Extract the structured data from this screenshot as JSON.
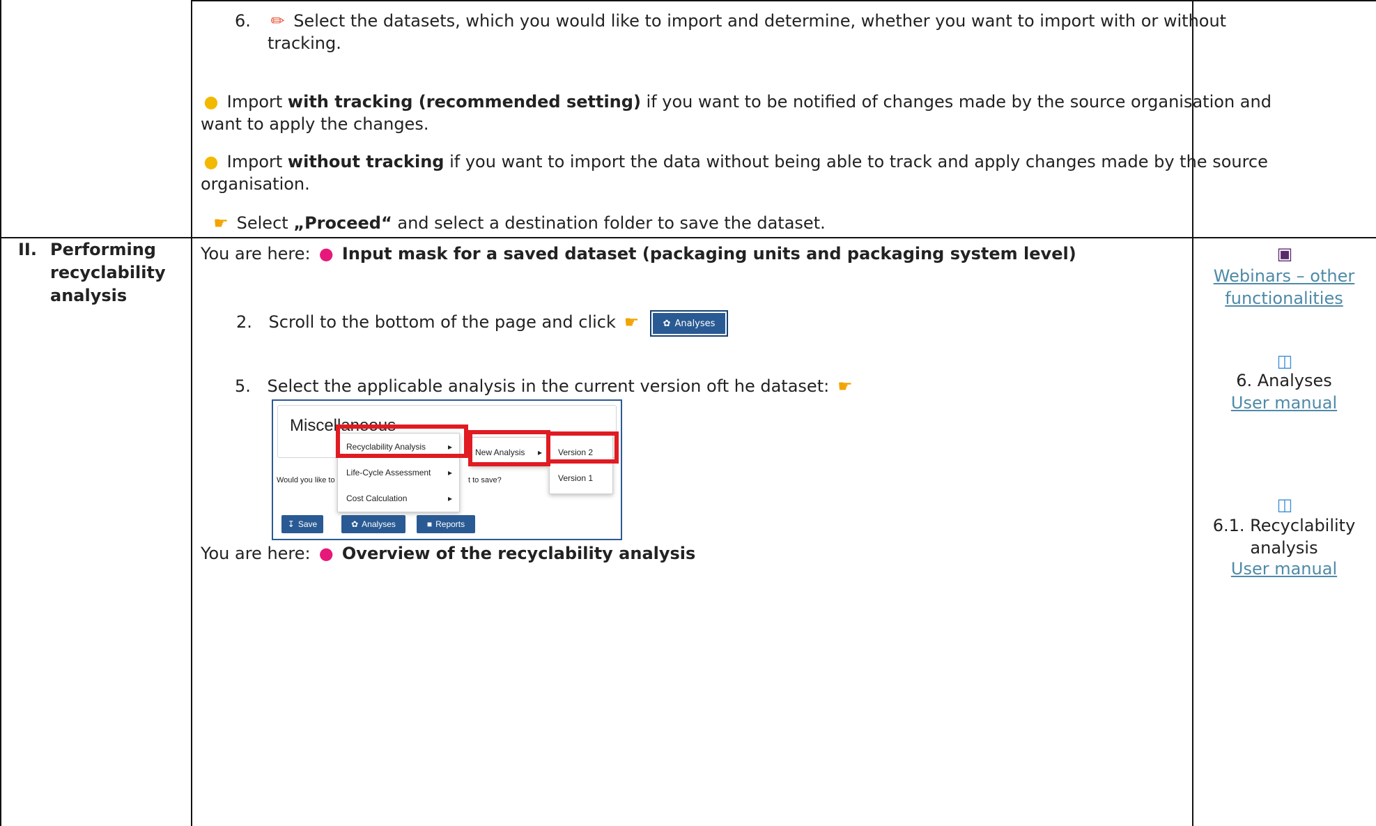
{
  "row_top": {
    "step6": {
      "num": "6.",
      "icon": "pencil-icon",
      "line1": "Select the datasets, which you would like to import and determine, whether you want to import with or without",
      "line2": "tracking."
    },
    "tip1": {
      "icon": "lightbulb-icon",
      "pre": "Import ",
      "bold": "with tracking (recommended setting)",
      "post": " if you want to be notified of changes made by the source organisation and",
      "line2": "want to apply the changes."
    },
    "tip2": {
      "icon": "lightbulb-icon",
      "pre": "Import ",
      "bold": "without tracking",
      "post": " if you want to import the data without being able to track and apply changes made by the source",
      "line2": "organisation."
    },
    "proceed": {
      "icon": "pointing-hand-icon",
      "pre": "Select ",
      "bold": "„Proceed“",
      "post": " and select a destination folder to save the dataset."
    }
  },
  "row_main": {
    "section": {
      "num": "II.",
      "title_lines": [
        "Performing",
        "recyclability",
        "analysis"
      ]
    },
    "here1": {
      "pre": "You are here:",
      "icon": "pin-icon",
      "bold": "Input mask for a saved dataset (packaging units and packaging system level)"
    },
    "step2": {
      "num": "2.",
      "text": "Scroll to the bottom of the page and click",
      "icon": "pointing-hand-icon",
      "button_label": "Analyses"
    },
    "step5": {
      "num": "5.",
      "text": "Select the applicable analysis in the current version oft he dataset:",
      "icon": "pointing-hand-icon"
    },
    "screenshot": {
      "title": "Miscellaneous",
      "question": "Would you like to",
      "question_tail": "t to save?",
      "menu1": [
        "Recyclability Analysis",
        "Life-Cycle Assessment",
        "Cost Calculation"
      ],
      "menu2": [
        "New Analysis"
      ],
      "menu3": [
        "Version 2",
        "Version 1"
      ],
      "buttons": [
        "Save",
        "Analyses",
        "Reports"
      ]
    },
    "here2": {
      "pre": "You are here:",
      "icon": "pin-icon",
      "bold": "Overview of the recyclability analysis"
    },
    "resources": {
      "webinars": {
        "icon": "camera-icon",
        "link_lines": [
          "Webinars – other",
          "functionalities"
        ]
      },
      "analyses": {
        "icon": "book-icon",
        "title": "6. Analyses",
        "link": "User manual"
      },
      "recyclability": {
        "icon": "book-icon",
        "title_lines": [
          "6.1. Recyclability",
          "analysis"
        ],
        "link": "User manual"
      }
    }
  },
  "colors": {
    "button_blue": "#2a5a93",
    "highlight_red": "#e01b22",
    "link": "#4e8aa8"
  }
}
